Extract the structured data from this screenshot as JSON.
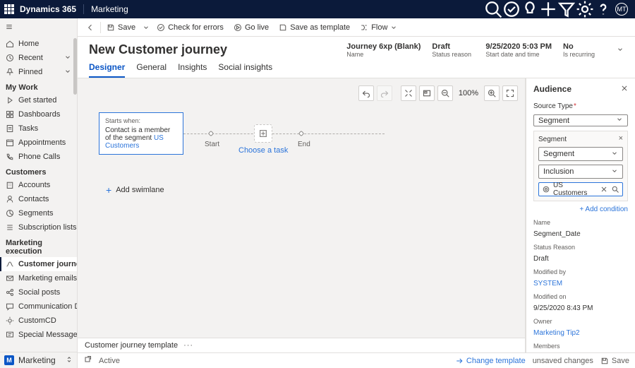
{
  "app": {
    "brand": "Dynamics 365",
    "module": "Marketing",
    "avatar": "MT"
  },
  "nav": {
    "home": "Home",
    "recent": "Recent",
    "pinned": "Pinned",
    "sec_mywork": "My Work",
    "get_started": "Get started",
    "dashboards": "Dashboards",
    "tasks": "Tasks",
    "appointments": "Appointments",
    "phone_calls": "Phone Calls",
    "sec_customers": "Customers",
    "accounts": "Accounts",
    "contacts": "Contacts",
    "segments": "Segments",
    "sub_lists": "Subscription lists",
    "sec_marketing_exec": "Marketing execution",
    "customer_journeys": "Customer journeys",
    "marketing_emails": "Marketing emails",
    "social_posts": "Social posts",
    "communication": "Communication D...",
    "customcd": "CustomCD",
    "special_messages": "Special Messages",
    "area": "Marketing"
  },
  "cmd": {
    "save": "Save",
    "check": "Check for errors",
    "golive": "Go live",
    "save_template": "Save as template",
    "flow": "Flow"
  },
  "record": {
    "title": "New Customer journey",
    "name_val": "Journey 6xp (Blank)",
    "name_lbl": "Name",
    "status_val": "Draft",
    "status_lbl": "Status reason",
    "start_val": "9/25/2020 5:03 PM",
    "start_lbl": "Start date and time",
    "recur_val": "No",
    "recur_lbl": "Is recurring"
  },
  "tabs": {
    "designer": "Designer",
    "general": "General",
    "insights": "Insights",
    "social": "Social insights"
  },
  "designer": {
    "zoom": "100%",
    "starts_when": "Starts when:",
    "start_text_a": "Contact is a member of the segment ",
    "start_text_seg": "US Customers",
    "lbl_start": "Start",
    "lbl_end": "End",
    "choose_task": "Choose a task",
    "add_swimlane": "Add swimlane",
    "template_footer": "Customer journey template"
  },
  "audience": {
    "title": "Audience",
    "source_type_lbl": "Source Type",
    "source_type_val": "Segment",
    "seg_block_lbl": "Segment",
    "seg_select_val": "Segment",
    "inclusion_val": "Inclusion",
    "seg_pill_val": "US Customers",
    "add_condition": "+ Add condition",
    "name_lbl": "Name",
    "name_val": "Segment_Date",
    "status_lbl": "Status Reason",
    "status_val": "Draft",
    "modby_lbl": "Modified by",
    "modby_val": "SYSTEM",
    "modon_lbl": "Modified on",
    "modon_val": "9/25/2020 8:43 PM",
    "owner_lbl": "Owner",
    "owner_val": "Marketing Tip2",
    "members_lbl": "Members"
  },
  "status": {
    "active": "Active",
    "unsaved": "unsaved changes",
    "change_template": "Change template",
    "save": "Save"
  }
}
